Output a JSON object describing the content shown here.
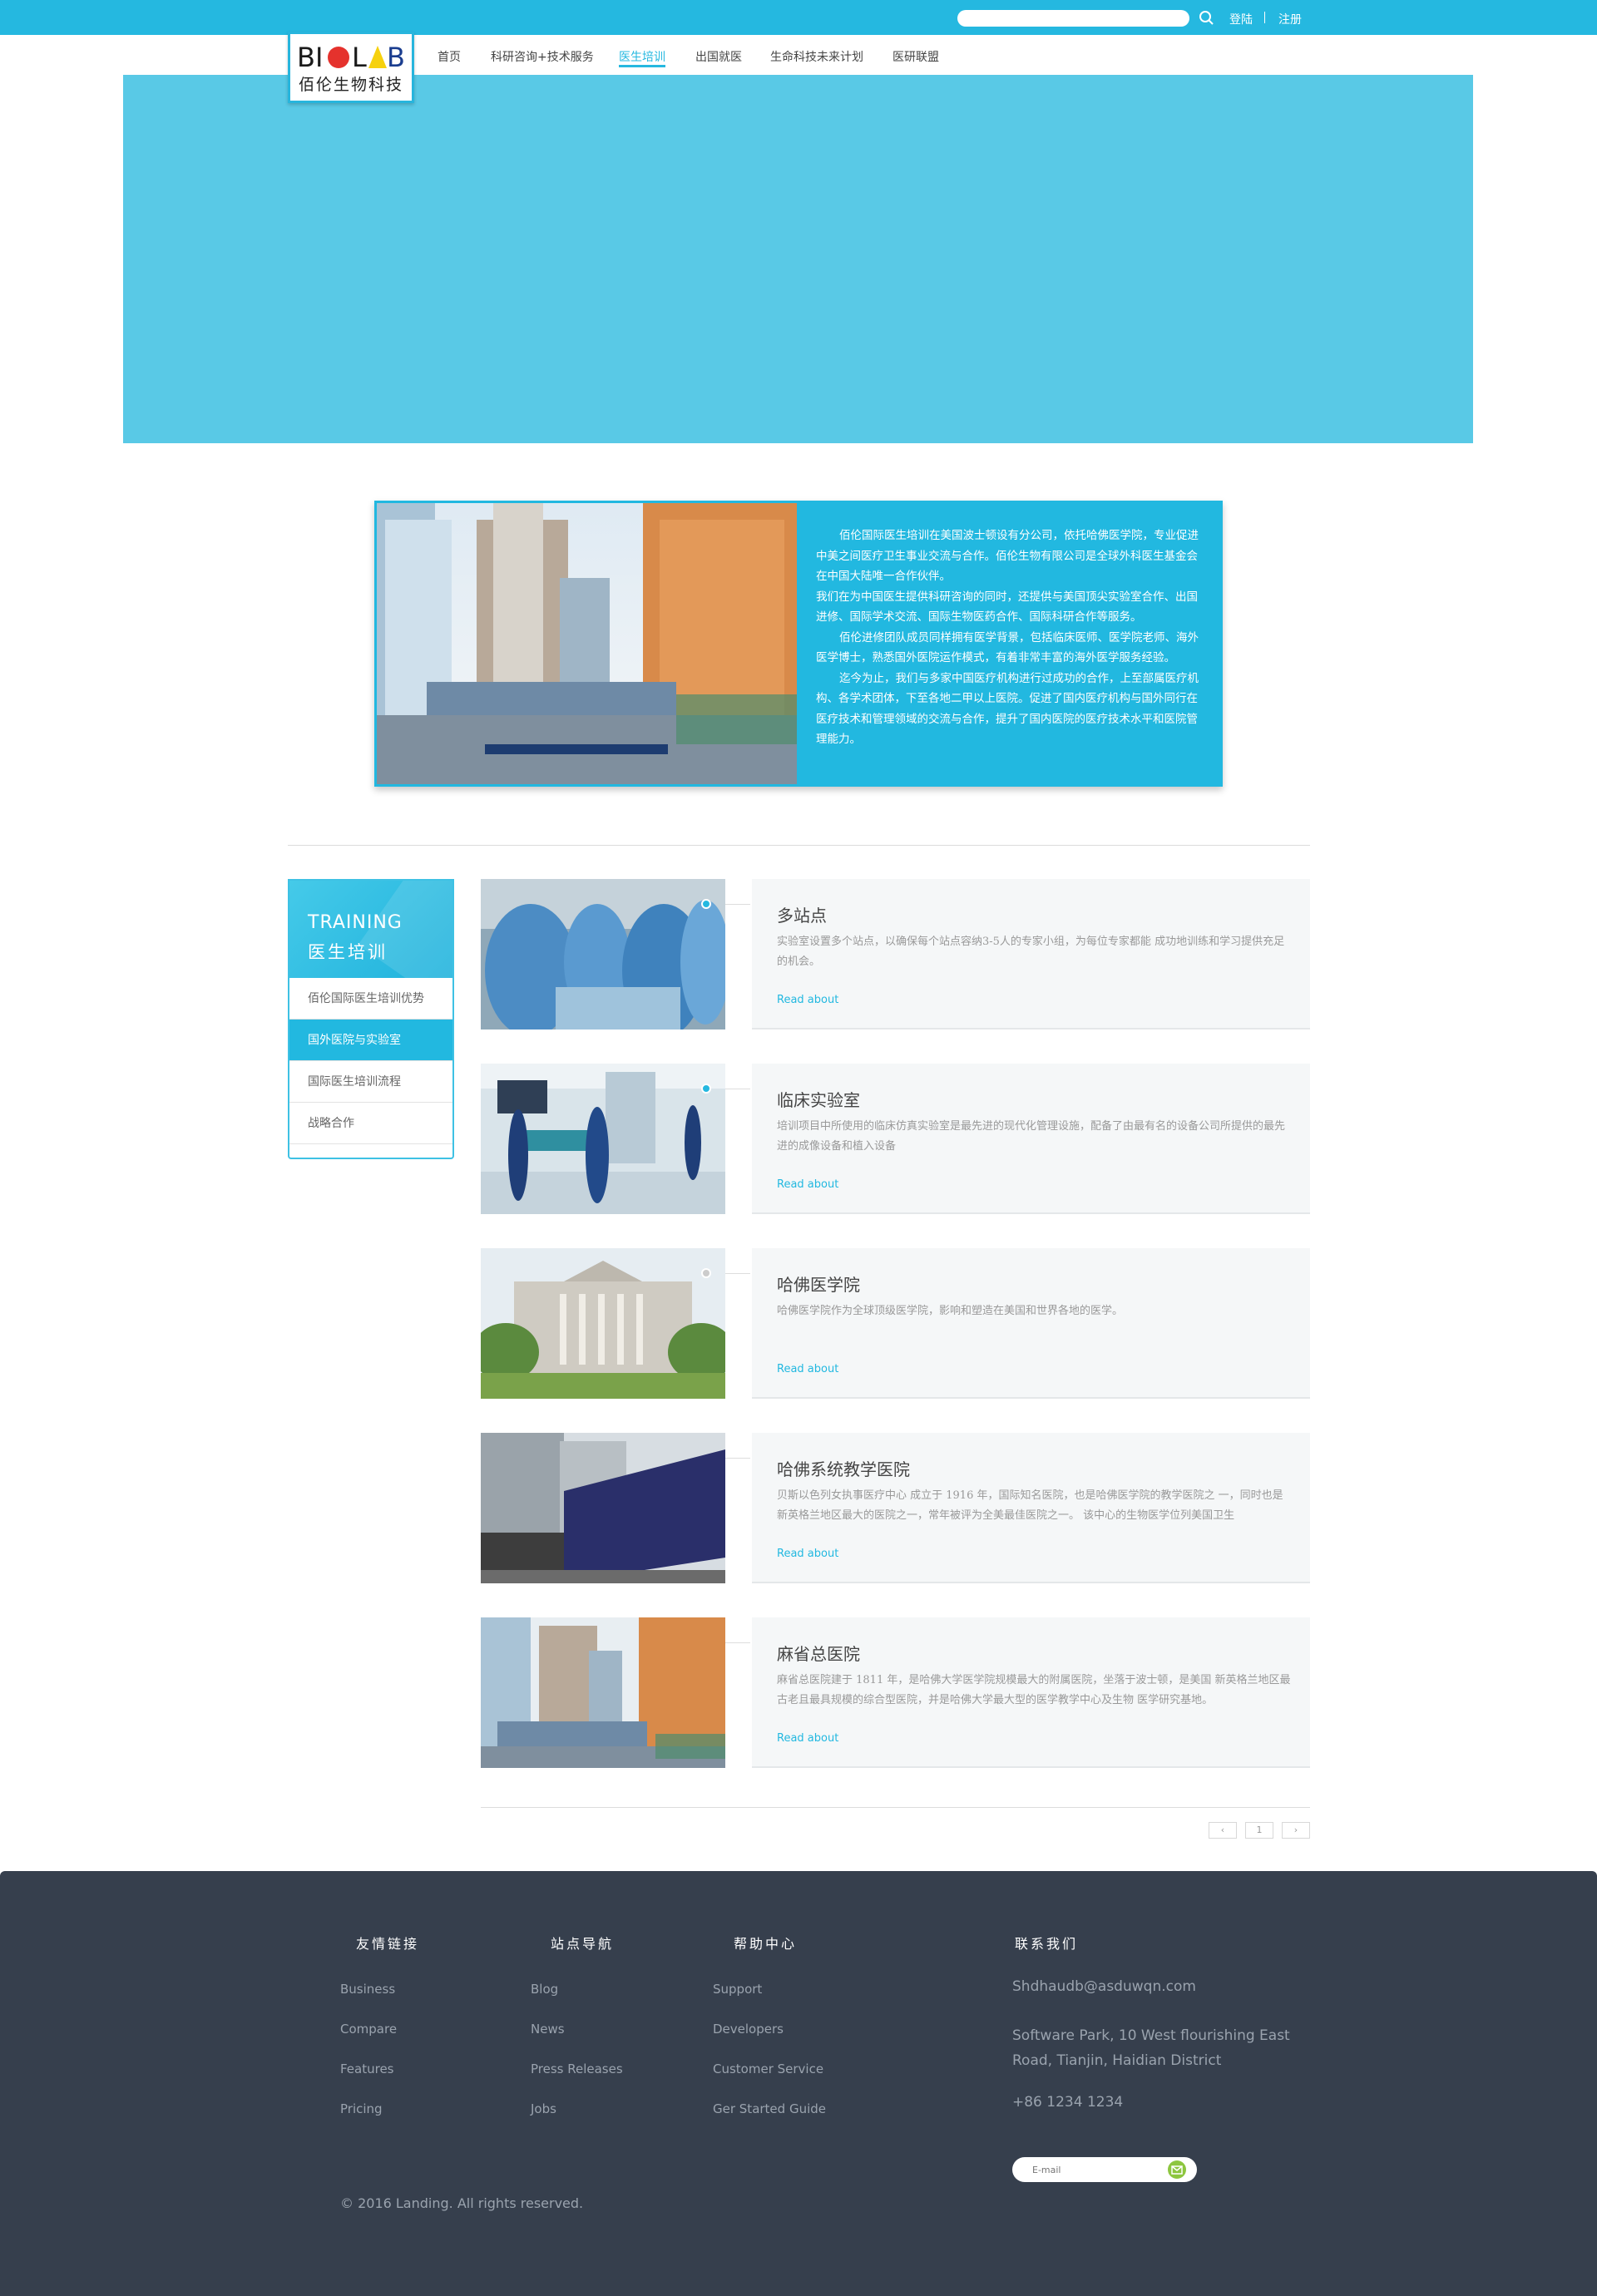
{
  "topbar": {
    "search_placeholder": "",
    "login": "登陆",
    "register": "注册",
    "icons": {
      "search": "search-icon"
    }
  },
  "logo": {
    "en": "BIOLAB",
    "cn": "佰伦生物科技"
  },
  "nav": {
    "items": [
      {
        "label": "首页"
      },
      {
        "label": "科研咨询+技术服务"
      },
      {
        "label": "医生培训"
      },
      {
        "label": "出国就医"
      },
      {
        "label": "生命科技未来计划"
      },
      {
        "label": "医研联盟"
      }
    ],
    "active_index": 2
  },
  "intro": {
    "paragraphs": [
      "佰伦国际医生培训在美国波士顿设有分公司，依托哈佛医学院，专业促进中美之间医疗卫生事业交流与合作。佰伦生物有限公司是全球外科医生基金会在中国大陆唯一合作伙伴。",
      "我们在为中国医生提供科研咨询的同时，还提供与美国顶尖实验室合作、出国进修、国际学术交流、国际生物医药合作、国际科研合作等服务。",
      "佰伦进修团队成员同样拥有医学背景，包括临床医师、医学院老师、海外医学博士，熟悉国外医院运作模式，有着非常丰富的海外医学服务经验。",
      "迄今为止，我们与多家中国医疗机构进行过成功的合作，上至部属医疗机构、各学术团体，下至各地二甲以上医院。促进了国内医疗机构与国外同行在医疗技术和管理领域的交流与合作，提升了国内医院的医疗技术水平和医院管理能力。"
    ]
  },
  "sidebar": {
    "title_en": "TRAINING",
    "title_cn": "医生培训",
    "items": [
      {
        "label": "佰伦国际医生培训优势"
      },
      {
        "label": "国外医院与实验室"
      },
      {
        "label": "国际医生培训流程"
      },
      {
        "label": "战略合作"
      }
    ],
    "active_index": 1
  },
  "list": [
    {
      "title": "多站点",
      "desc": "实验室设置多个站点，以确保每个站点容纳3-5人的专家小组，为每位专家都能 成功地训练和学习提供充足的机会。",
      "more": "Read about"
    },
    {
      "title": "临床实验室",
      "desc": "培训项目中所使用的临床仿真实验室是最先进的现代化管理设施，配备了由最有名的设备公司所提供的最先进的成像设备和植入设备",
      "more": "Read about"
    },
    {
      "title": "哈佛医学院",
      "desc": "哈佛医学院作为全球顶级医学院，影响和塑造在美国和世界各地的医学。",
      "more": "Read about"
    },
    {
      "title": "哈佛系统教学医院",
      "desc": "贝斯以色列女执事医疗中心 成立于 1916 年，国际知名医院，也是哈佛医学院的教学医院之 一，同时也是新英格兰地区最大的医院之一，常年被评为全美最佳医院之一。 该中心的生物医学位列美国卫生",
      "more": "Read about"
    },
    {
      "title": "麻省总医院",
      "desc": "麻省总医院建于 1811 年，是哈佛大学医学院规模最大的附属医院，坐落于波士顿，是美国 新英格兰地区最古老且最具规模的综合型医院，并是哈佛大学最大型的医学教学中心及生物 医学研究基地。",
      "more": "Read about"
    }
  ],
  "pagination": {
    "prev": "‹",
    "page": "1",
    "next": "›"
  },
  "footer": {
    "columns": [
      {
        "title": "友情链接",
        "links": [
          "Business",
          "Compare",
          "Features",
          "Pricing"
        ]
      },
      {
        "title": "站点导航",
        "links": [
          "Blog",
          "News",
          "Press Releases",
          "Jobs"
        ]
      },
      {
        "title": "帮助中心",
        "links": [
          "Support",
          "Developers",
          "Customer Service",
          "Ger Started Guide"
        ]
      }
    ],
    "contact": {
      "title": "联系我们",
      "email": "Shdhaudb@asduwqn.com",
      "address": "Software Park, 10 West flourishing East Road, Tianjin, Haidian District",
      "phone": "+86 1234 1234"
    },
    "newsletter_placeholder": "E-mail",
    "copyright": "© 2016 Landing. All rights reserved."
  },
  "colors": {
    "brand": "#25b8e0",
    "banner": "#59c9e6",
    "footer_bg": "#363f4d",
    "newsletter_btn": "#8dc63f"
  }
}
